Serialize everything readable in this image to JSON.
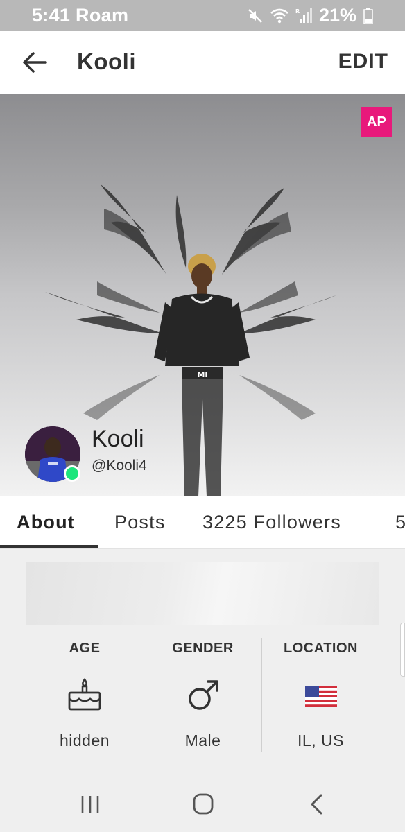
{
  "status_bar": {
    "time_carrier": "5:41 Roam",
    "battery": "21%",
    "icons": [
      "mute-icon",
      "wifi-icon",
      "signal-icon",
      "battery-icon"
    ]
  },
  "header": {
    "title": "Kooli",
    "edit_label": "EDIT",
    "back_icon": "arrow-left-icon"
  },
  "hero": {
    "badge": "AP",
    "shirt_text": "MI"
  },
  "profile": {
    "name": "Kooli",
    "handle": "@Kooli4",
    "online": true
  },
  "tabs": [
    {
      "label": "About",
      "active": true
    },
    {
      "label": "Posts",
      "active": false
    },
    {
      "label": "3225 Followers",
      "active": false
    },
    {
      "label": "5",
      "active": false
    }
  ],
  "info": [
    {
      "label": "AGE",
      "icon": "birthday-cake-icon",
      "value": "hidden"
    },
    {
      "label": "GENDER",
      "icon": "male-symbol-icon",
      "value": "Male"
    },
    {
      "label": "LOCATION",
      "icon": "us-flag-icon",
      "value": "IL, US"
    }
  ],
  "nav_bar": {
    "icons": [
      "recent-apps-icon",
      "home-icon",
      "back-icon"
    ]
  },
  "colors": {
    "badge": "#e8197b",
    "online": "#1de67c",
    "status_bar": "#b8b8b8"
  }
}
